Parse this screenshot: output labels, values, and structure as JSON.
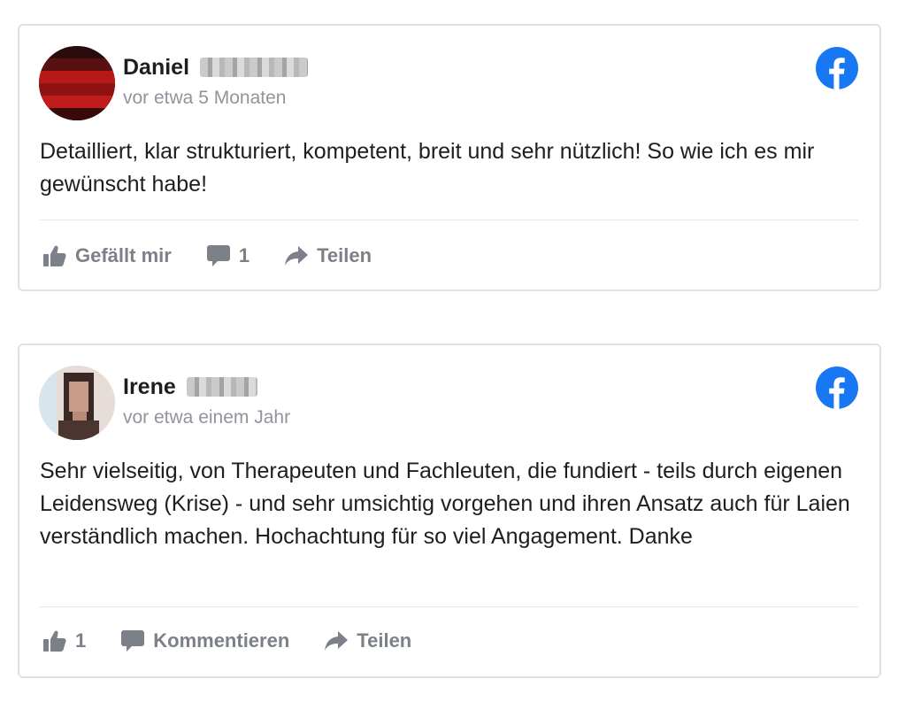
{
  "reviews": [
    {
      "first_name": "Daniel",
      "time": "vor etwa 5 Monaten",
      "text": "Detailliert, klar strukturiert, kompetent, breit und sehr nützlich! So wie ich es mir gewünscht habe!",
      "actions": {
        "like_label": "Gefällt mir",
        "comment_label": "1",
        "share_label": "Teilen"
      }
    },
    {
      "first_name": "Irene",
      "time": "vor etwa einem Jahr",
      "text": "Sehr vielseitig, von Therapeuten und Fachleuten, die fundiert - teils durch eigenen Leidensweg (Krise) - und sehr umsichtig vorgehen und ihren Ansatz auch für Laien verständlich machen. Hochachtung für so viel Angagement. Danke",
      "actions": {
        "like_label": "1",
        "comment_label": "Kommentieren",
        "share_label": "Teilen"
      }
    }
  ],
  "icons": {
    "brand": "facebook-icon",
    "like": "thumbs-up-icon",
    "comment": "comment-bubble-icon",
    "share": "share-arrow-icon"
  },
  "colors": {
    "facebook_blue": "#1877f2",
    "action_gray": "#7c8088",
    "time_gray": "#90949c",
    "text": "#1c1e21"
  }
}
